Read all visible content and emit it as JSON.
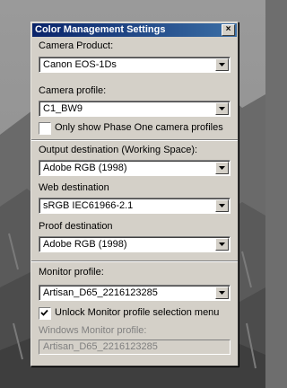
{
  "dialog": {
    "title": "Color Management Settings",
    "close_glyph": "×"
  },
  "camera": {
    "product_label": "Camera Product:",
    "product_value": "Canon EOS-1Ds",
    "profile_label": "Camera profile:",
    "profile_value": "C1_BW9",
    "phase_one_only_label": "Only show Phase One camera profiles",
    "phase_one_only_checked": false
  },
  "output": {
    "label": "Output destination (Working Space):",
    "value": "Adobe RGB (1998)",
    "web_label": "Web destination",
    "web_value": "sRGB IEC61966-2.1",
    "proof_label": "Proof destination",
    "proof_value": "Adobe RGB (1998)"
  },
  "monitor": {
    "label": "Monitor profile:",
    "value": "Artisan_D65_2216123285",
    "unlock_label": "Unlock Monitor profile selection menu",
    "unlock_checked": true,
    "windows_label": "Windows Monitor profile:",
    "windows_value": "Artisan_D65_2216123285"
  },
  "icons": {
    "dropdown": "chevron-down-icon",
    "check": "checkmark-icon"
  },
  "colors": {
    "title_start": "#0a246a",
    "title_end": "#3a6ea5",
    "face": "#d4d0c8"
  }
}
